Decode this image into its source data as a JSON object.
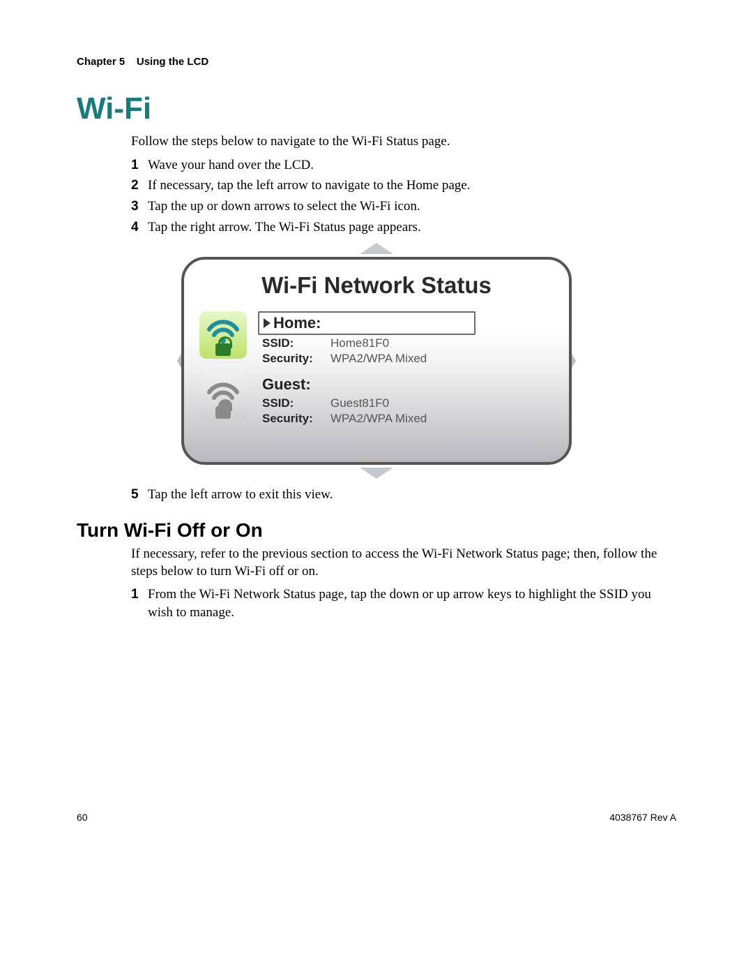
{
  "header": {
    "chapter_label": "Chapter 5",
    "chapter_title": "Using the LCD"
  },
  "section": {
    "title": "Wi-Fi",
    "intro": "Follow the steps below to navigate to the Wi-Fi Status page.",
    "steps_a": [
      "Wave your hand over the LCD.",
      "If necessary, tap the left arrow to navigate to the Home page.",
      "Tap the up or down arrows to select the Wi-Fi icon.",
      "Tap the right arrow. The Wi-Fi Status page appears."
    ],
    "step5": "Tap the left arrow to exit this view."
  },
  "lcd": {
    "panel_title": "Wi-Fi Network Status",
    "networks": [
      {
        "name": "Home:",
        "ssid_label": "SSID:",
        "ssid": "Home81F0",
        "sec_label": "Security:",
        "security": "WPA2/WPA Mixed",
        "selected": true,
        "enabled": true
      },
      {
        "name": "Guest:",
        "ssid_label": "SSID:",
        "ssid": "Guest81F0",
        "sec_label": "Security:",
        "security": "WPA2/WPA Mixed",
        "selected": false,
        "enabled": false
      }
    ]
  },
  "subsection": {
    "title": "Turn Wi-Fi Off or On",
    "intro": "If necessary, refer to the previous section to access the Wi-Fi Network Status page; then, follow the steps below to turn Wi-Fi off or on.",
    "steps": [
      "From the Wi-Fi Network Status page, tap the down or up arrow keys to highlight the SSID you wish to manage."
    ]
  },
  "footer": {
    "page_number": "60",
    "doc_rev": "4038767 Rev A"
  }
}
